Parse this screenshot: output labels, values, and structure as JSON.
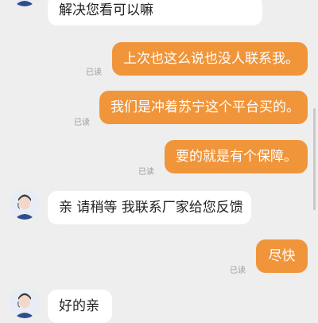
{
  "colors": {
    "background": "#eeeeee",
    "incoming_bubble": "#ffffff",
    "outgoing_bubble": "#f0953a",
    "read_text": "#9a9a9a"
  },
  "messages": [
    {
      "side": "in",
      "text": "解决您看可以嘛"
    },
    {
      "side": "out",
      "text": "上次也这么说也没人联系我。",
      "status": "已读"
    },
    {
      "side": "out",
      "text": "我们是冲着苏宁这个平台买的。",
      "status": "已读"
    },
    {
      "side": "out",
      "text": "要的就是有个保障。",
      "status": "已读"
    },
    {
      "side": "in",
      "text": "亲 请稍等 我联系厂家给您反馈"
    },
    {
      "side": "out",
      "text": "尽快",
      "status": "已读"
    },
    {
      "side": "in",
      "text": "好的亲"
    }
  ],
  "icons": {
    "agent_avatar": "customer-service-agent-avatar-icon"
  }
}
